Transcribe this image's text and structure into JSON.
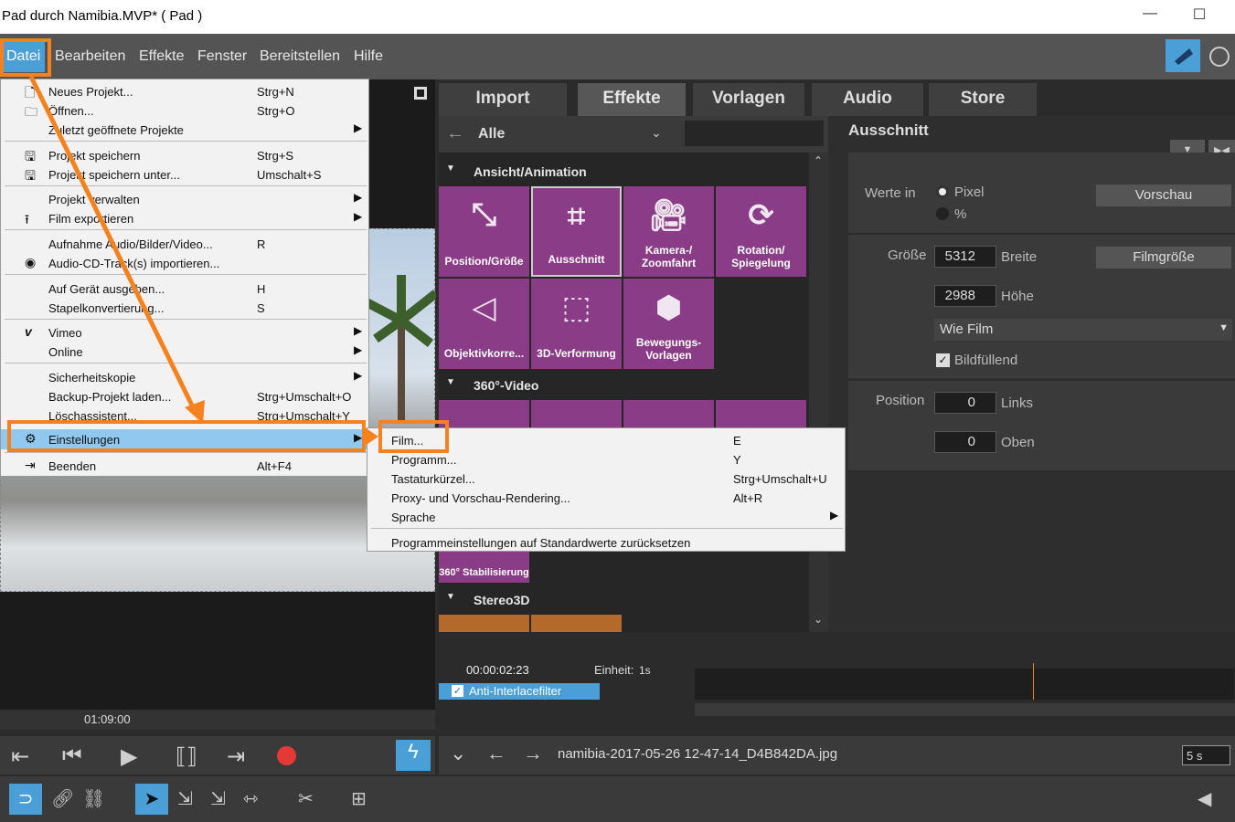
{
  "window": {
    "title": "Pad durch Namibia.MVP* ( Pad )",
    "minimize": "—",
    "maximize": "☐"
  },
  "menubar": [
    "Datei",
    "Bearbeiten",
    "Effekte",
    "Fenster",
    "Bereitstellen",
    "Hilfe"
  ],
  "tabs": [
    "Import",
    "Effekte",
    "Vorlagen",
    "Audio",
    "Store"
  ],
  "effects": {
    "back": "←",
    "filter": "Alle",
    "categories": [
      {
        "name": "Ansicht/Animation",
        "tiles": [
          "Position/Größe",
          "Ausschnitt",
          "Kamera-/ Zoomfahrt",
          "Rotation/ Spiegelung",
          "Objektivkorre...",
          "3D-Verformung",
          "Bewegungs-Vorlagen"
        ]
      },
      {
        "name": "360°-Video",
        "tiles": [
          "360° Stabilisierung"
        ]
      },
      {
        "name": "Stereo3D",
        "tiles": []
      }
    ]
  },
  "properties": {
    "title": "Ausschnitt",
    "werte_in": "Werte in",
    "unit_pixel": "Pixel",
    "unit_percent": "%",
    "vorschau": "Vorschau",
    "groesse": "Größe",
    "breite_val": "5312",
    "breite": "Breite",
    "filmgroesse": "Filmgröße",
    "hoehe_val": "2988",
    "hoehe": "Höhe",
    "aspect": "Wie Film",
    "bildfuellend": "Bildfüllend",
    "position": "Position",
    "links_val": "0",
    "links": "Links",
    "oben_val": "0",
    "oben": "Oben"
  },
  "keyframes": {
    "time": "00:00:02:23",
    "unit": "Einheit:",
    "unit_val": "1s",
    "filter": "Anti-Interlacefilter"
  },
  "preview": {
    "timecode": "01:09:00"
  },
  "status": {
    "filename": "namibia-2017-05-26 12-47-14_D4B842DA.jpg",
    "duration": "5 s"
  },
  "file_menu": [
    {
      "label": "Neues Projekt...",
      "shortcut": "Strg+N",
      "icon": "new-file-icon"
    },
    {
      "label": "Öffnen...",
      "shortcut": "Strg+O",
      "icon": "folder-icon"
    },
    {
      "label": "Zuletzt geöffnete Projekte",
      "shortcut": "",
      "arrow": true
    },
    {
      "label": "Projekt speichern",
      "shortcut": "Strg+S",
      "icon": "save-icon"
    },
    {
      "label": "Projekt speichern unter...",
      "shortcut": "Umschalt+S",
      "icon": "save-as-icon"
    },
    {
      "label": "Projekt verwalten",
      "shortcut": "",
      "arrow": true
    },
    {
      "label": "Film exportieren",
      "shortcut": "",
      "arrow": true,
      "icon": "export-icon"
    },
    {
      "label": "Aufnahme Audio/Bilder/Video...",
      "shortcut": "R"
    },
    {
      "label": "Audio-CD-Track(s) importieren...",
      "shortcut": "",
      "icon": "cd-icon"
    },
    {
      "label": "Auf Gerät ausgeben...",
      "shortcut": "H"
    },
    {
      "label": "Stapelkonvertierung...",
      "shortcut": "S"
    },
    {
      "label": "Vimeo",
      "shortcut": "",
      "arrow": true,
      "icon": "vimeo-icon"
    },
    {
      "label": "Online",
      "shortcut": "",
      "arrow": true
    },
    {
      "label": "Sicherheitskopie",
      "shortcut": "",
      "arrow": true
    },
    {
      "label": "Backup-Projekt laden...",
      "shortcut": "Strg+Umschalt+O"
    },
    {
      "label": "Löschassistent...",
      "shortcut": "Strg+Umschalt+Y"
    },
    {
      "label": "Einstellungen",
      "shortcut": "",
      "arrow": true,
      "icon": "gear-icon"
    },
    {
      "label": "Beenden",
      "shortcut": "Alt+F4",
      "icon": "exit-icon"
    }
  ],
  "settings_menu": [
    {
      "label": "Film...",
      "shortcut": "E"
    },
    {
      "label": "Programm...",
      "shortcut": "Y"
    },
    {
      "label": "Tastaturkürzel...",
      "shortcut": "Strg+Umschalt+U"
    },
    {
      "label": "Proxy- und Vorschau-Rendering...",
      "shortcut": "Alt+R"
    },
    {
      "label": "Sprache",
      "shortcut": "",
      "arrow": true
    },
    {
      "label": "Programmeinstellungen auf Standardwerte zurücksetzen",
      "shortcut": ""
    }
  ],
  "colors": {
    "accent": "#4a9fd6",
    "highlight": "#90c8ef",
    "annotation": "#f5821f",
    "tile": "#8a3d86",
    "record": "#e53935"
  }
}
